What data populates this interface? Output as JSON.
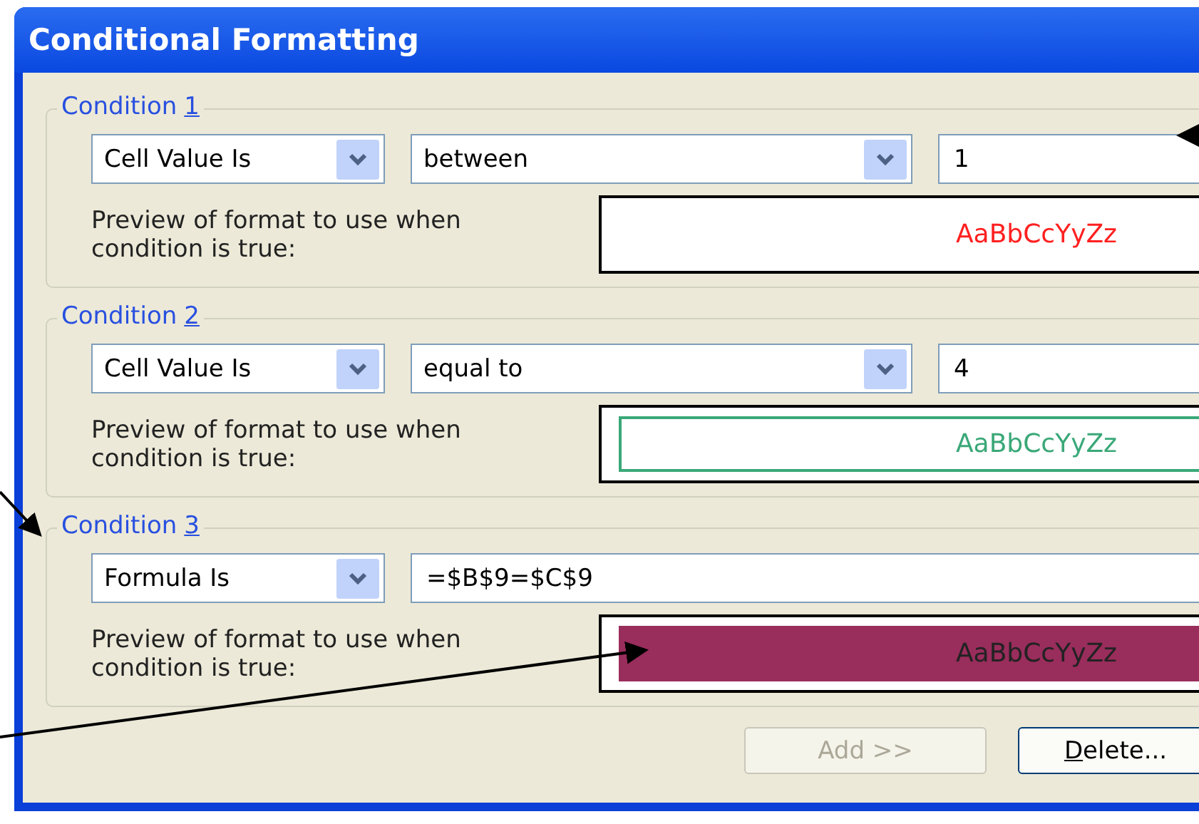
{
  "window": {
    "title": "Conditional Formatting"
  },
  "conditions": [
    {
      "label": "Condition",
      "number": "1",
      "type": "Cell Value Is",
      "operator": "between",
      "value": "1",
      "preview_label": "Preview of format to use when condition is true:",
      "preview": {
        "kind": "font",
        "color": "#ff2020",
        "text": "AaBbCcYyZz"
      }
    },
    {
      "label": "Condition",
      "number": "2",
      "type": "Cell Value Is",
      "operator": "equal to",
      "value": "4",
      "preview_label": "Preview of format to use when condition is true:",
      "preview": {
        "kind": "border",
        "color": "#3aa878",
        "text": "AaBbCcYyZz"
      }
    },
    {
      "label": "Condition",
      "number": "3",
      "type": "Formula Is",
      "formula": "=$B$9=$C$9",
      "preview_label": "Preview of format to use when condition is true:",
      "preview": {
        "kind": "fill",
        "color": "#992d5c",
        "text": "AaBbCcYyZz"
      }
    }
  ],
  "buttons": [
    {
      "rest": "Add >>",
      "disabled": true
    },
    {
      "accel": "D",
      "rest": "elete...",
      "disabled": false
    }
  ]
}
